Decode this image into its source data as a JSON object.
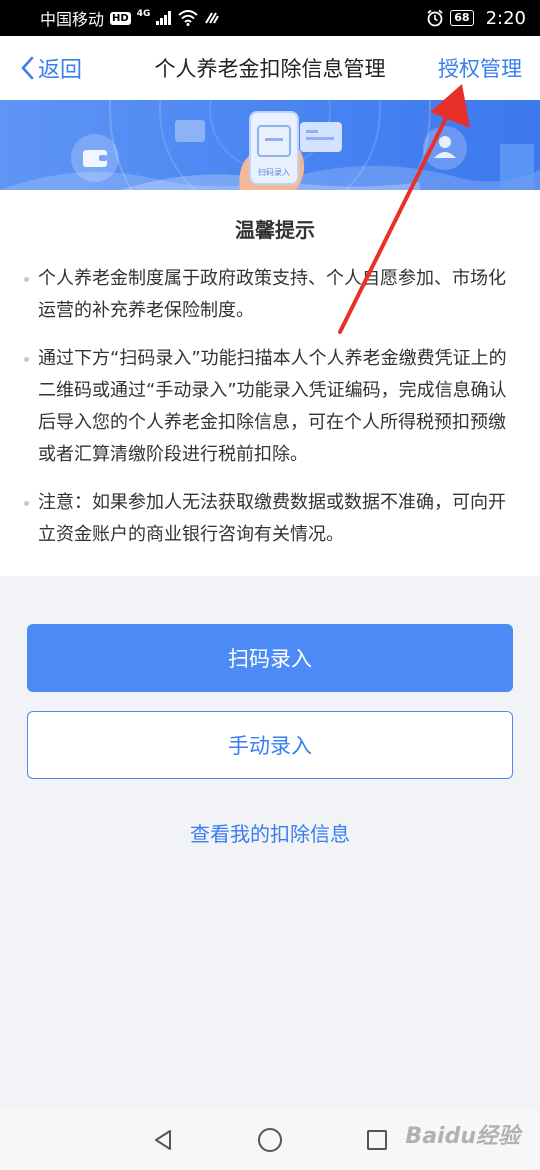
{
  "status_bar": {
    "carrier": "中国移动",
    "hd": "HD",
    "network": "4G",
    "battery": "68",
    "time": "2:20"
  },
  "nav": {
    "back_label": "返回",
    "title": "个人养老金扣除信息管理",
    "auth_label": "授权管理"
  },
  "banner": {
    "phone_label": "扫码录入"
  },
  "tips": {
    "title": "温馨提示",
    "items": [
      "个人养老金制度属于政府政策支持、个人自愿参加、市场化运营的补充养老保险制度。",
      "通过下方“扫码录入”功能扫描本人个人养老金缴费凭证上的二维码或通过“手动录入”功能录入凭证编码，完成信息确认后导入您的个人养老金扣除信息，可在个人所得税预扣预缴或者汇算清缴阶段进行税前扣除。",
      "注意：如果参加人无法获取缴费数据或数据不准确，可向开立资金账户的商业银行咨询有关情况。"
    ]
  },
  "actions": {
    "scan_label": "扫码录入",
    "manual_label": "手动录入",
    "view_label": "查看我的扣除信息"
  },
  "watermark": "Baidu经验",
  "colors": {
    "accent": "#4c8bf5",
    "link": "#3a7ef0",
    "annotation_arrow": "#e8302a"
  }
}
